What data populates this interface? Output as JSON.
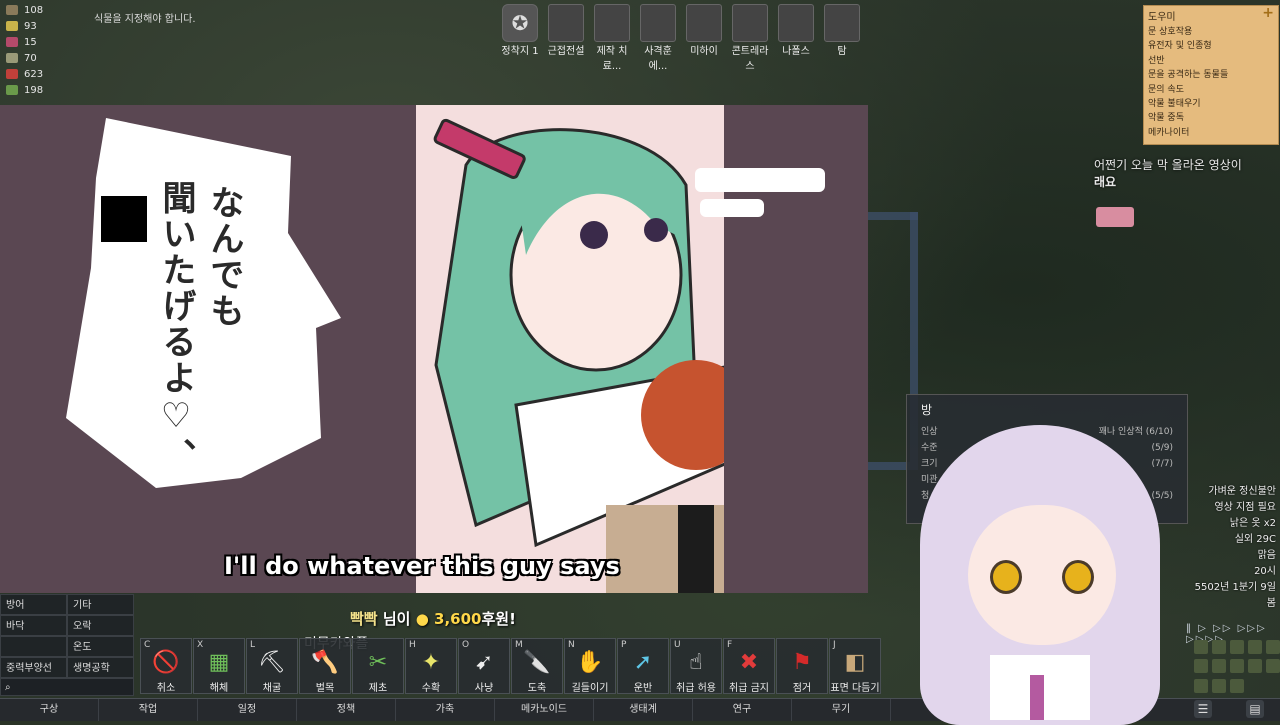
{
  "resources": [
    {
      "value": "108",
      "color": "#8a7a5a"
    },
    {
      "value": "93",
      "color": "#c9b34a"
    },
    {
      "value": "15",
      "color": "#b44a6a"
    },
    {
      "value": "70",
      "color": "#9a9a78"
    },
    {
      "value": "623",
      "color": "#c0403a"
    },
    {
      "value": "198",
      "color": "#6a9a4a"
    }
  ],
  "alert_top": "식물을 지정해야 합니다.",
  "colonists": [
    {
      "label": "정착지 1"
    },
    {
      "label": "근접전설"
    },
    {
      "label": "제작 치료..."
    },
    {
      "label": "사격훈에..."
    },
    {
      "label": "미하이"
    },
    {
      "label": "콘트레라스"
    },
    {
      "label": "나폴스"
    },
    {
      "label": "탐"
    }
  ],
  "helper": {
    "title": "도우미",
    "plus": "+",
    "items": [
      "문 상호작용",
      "유전자 및 인종형",
      "선반",
      "문을 공격하는 동물들",
      "문의 속도",
      "악물 불태우기",
      "악물 중독",
      "메카나이터"
    ]
  },
  "message": {
    "line1": "어쩐기 오늘 막 올라온 영상이",
    "line2": "래요"
  },
  "video": {
    "jp_col1": "なんでも",
    "jp_col2": "聞いたげるよ♡、",
    "subtitle": "I'll do whatever this guy says"
  },
  "room": {
    "title": "방",
    "rows": [
      {
        "label": "인상",
        "value": "꽤나 인상적 (6/10)"
      },
      {
        "label": "수준",
        "value": "(5/9)"
      },
      {
        "label": "크기",
        "value": "(7/7)"
      },
      {
        "label": "미관",
        "value": ""
      },
      {
        "label": "청",
        "value": "(5/5)"
      }
    ]
  },
  "status": [
    "가벼운 정신불안",
    "영상 지점 필요",
    "낡은 옷 x2",
    "",
    "실외 29C",
    "맑음",
    "20시",
    "5502년 1분기 9일",
    "봄"
  ],
  "donation": {
    "name": "빡빡",
    "suffix": "님이",
    "amount": "3,600",
    "unit": "후원!"
  },
  "misc_label": "미무카와플",
  "left_menu": [
    "방어",
    "기타",
    "바닥",
    "오락",
    "",
    "온도",
    "중력부양선",
    "생명공학"
  ],
  "orders": [
    {
      "key": "C",
      "label": "취소",
      "icon": "🚫"
    },
    {
      "key": "X",
      "label": "해체",
      "icon": "▦"
    },
    {
      "key": "L",
      "label": "채굴",
      "icon": "⛏"
    },
    {
      "key": "",
      "label": "벌목",
      "icon": "🪓"
    },
    {
      "key": "",
      "label": "제초",
      "icon": "✂"
    },
    {
      "key": "H",
      "label": "수확",
      "icon": "✦"
    },
    {
      "key": "O",
      "label": "사냥",
      "icon": "➹"
    },
    {
      "key": "M",
      "label": "도축",
      "icon": "🔪"
    },
    {
      "key": "N",
      "label": "길들이기",
      "icon": "✋"
    },
    {
      "key": "P",
      "label": "운반",
      "icon": "➚"
    },
    {
      "key": "U",
      "label": "취급 허용",
      "icon": "☝"
    },
    {
      "key": "F",
      "label": "취급 금지",
      "icon": "✖"
    },
    {
      "key": "",
      "label": "점거",
      "icon": "⚑"
    },
    {
      "key": "J",
      "label": "표면 다듬기",
      "icon": "◧"
    }
  ],
  "tabs": [
    "구상",
    "작업",
    "일정",
    "정책",
    "가축",
    "메카노이드",
    "생태계",
    "연구",
    "무기"
  ],
  "speed": "‖ ▷ ▷▷ ▷▷▷ ▷▷▷▷",
  "colors": {
    "helper_bg": "#e5bb7e",
    "video_bg": "#5a4752",
    "tab_bg": "#26292d"
  }
}
